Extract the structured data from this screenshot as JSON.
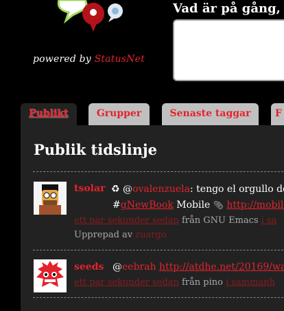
{
  "header": {
    "powered_prefix": "powered by",
    "powered_brand": "StatusNet",
    "notice_title": "Vad är på gång,"
  },
  "tabs": [
    {
      "label": "Publikt",
      "active": true
    },
    {
      "label": "Grupper",
      "active": false
    },
    {
      "label": "Senaste taggar",
      "active": false
    },
    {
      "label": "F",
      "active": false
    }
  ],
  "timeline": {
    "title": "Publik tidslinje",
    "notices": [
      {
        "author": "tsolar",
        "repeat_icon": "♻",
        "at": "@",
        "mention": "ovalenzuela",
        "text_1": ": tengo el orgullo de",
        "hash": "#",
        "tag": "gNewBook",
        "text_2": " Mobile ",
        "attach_icon": "paperclip-icon",
        "url": "http://mobile.",
        "time": "ett par sekunder sedan",
        "source": " från GNU Emacs ",
        "context": "i sa",
        "repeated_by_label": "Upprepad av ",
        "repeated_by": "zuargo"
      },
      {
        "author": "seeds",
        "at": "@",
        "mention": "eebrah",
        "url": "http://atdhe.net/20169/wa",
        "time": "ett par sekunder sedan",
        "source": " från pino ",
        "context": "i sammanh"
      }
    ]
  },
  "colors": {
    "accent": "#e4222c",
    "background": "#000000",
    "panel": "#222222",
    "tab": "#c0c0c0"
  }
}
